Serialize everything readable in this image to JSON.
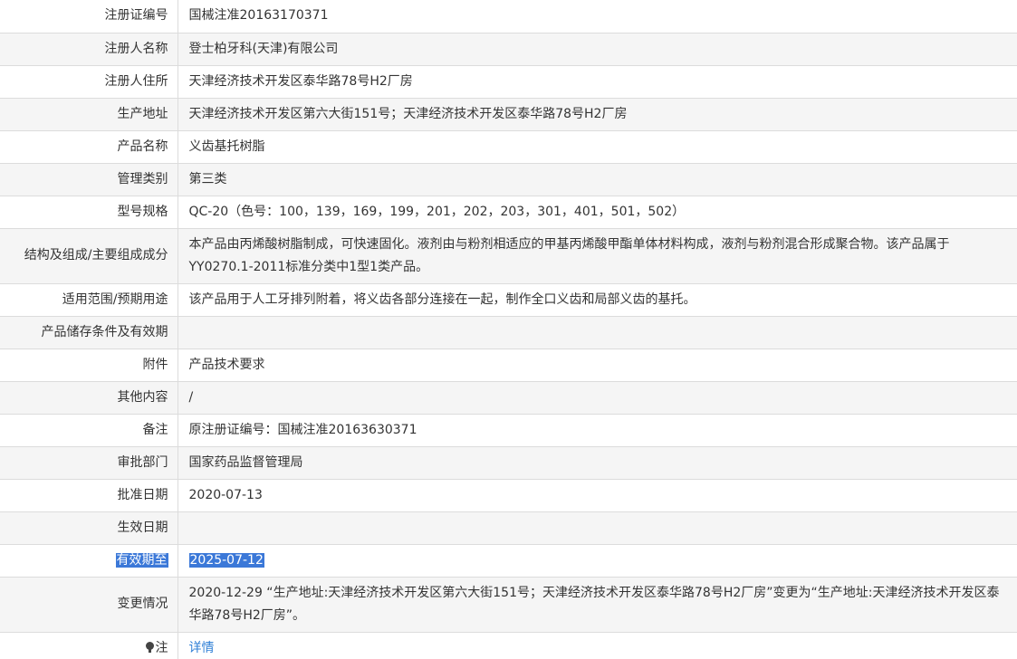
{
  "rows": [
    {
      "label": "注册证编号",
      "value": "国械注准20163170371"
    },
    {
      "label": "注册人名称",
      "value": "登士柏牙科(天津)有限公司"
    },
    {
      "label": "注册人住所",
      "value": "天津经济技术开发区泰华路78号H2厂房"
    },
    {
      "label": "生产地址",
      "value": "天津经济技术开发区第六大街151号；天津经济技术开发区泰华路78号H2厂房"
    },
    {
      "label": "产品名称",
      "value": "义齿基托树脂"
    },
    {
      "label": "管理类别",
      "value": "第三类"
    },
    {
      "label": "型号规格",
      "value": "QC-20（色号：100，139，169，199，201，202，203，301，401，501，502）"
    },
    {
      "label": "结构及组成/主要组成成分",
      "value": "本产品由丙烯酸树脂制成，可快速固化。液剂由与粉剂相适应的甲基丙烯酸甲酯单体材料构成，液剂与粉剂混合形成聚合物。该产品属于YY0270.1-2011标准分类中1型1类产品。"
    },
    {
      "label": "适用范围/预期用途",
      "value": "该产品用于人工牙排列附着，将义齿各部分连接在一起，制作全口义齿和局部义齿的基托。"
    },
    {
      "label": "产品储存条件及有效期",
      "value": ""
    },
    {
      "label": "附件",
      "value": "产品技术要求"
    },
    {
      "label": "其他内容",
      "value": "/"
    },
    {
      "label": "备注",
      "value": "原注册证编号：国械注准20163630371"
    },
    {
      "label": "审批部门",
      "value": "国家药品监督管理局"
    },
    {
      "label": "批准日期",
      "value": "2020-07-13"
    },
    {
      "label": "生效日期",
      "value": ""
    },
    {
      "label": "有效期至",
      "value": "2025-07-12"
    },
    {
      "label": "变更情况",
      "value": "2020-12-29 “生产地址:天津经济技术开发区第六大街151号；天津经济技术开发区泰华路78号H2厂房”变更为“生产地址:天津经济技术开发区泰华路78号H2厂房”。"
    }
  ],
  "note": {
    "icon": "bulb-icon",
    "label": "注",
    "link_text": "详情"
  },
  "colors": {
    "selection_highlight": "#3b78d8",
    "link": "#2f7fd6",
    "row_alt_background": "#f5f5f5",
    "border": "#dcdcdc"
  }
}
